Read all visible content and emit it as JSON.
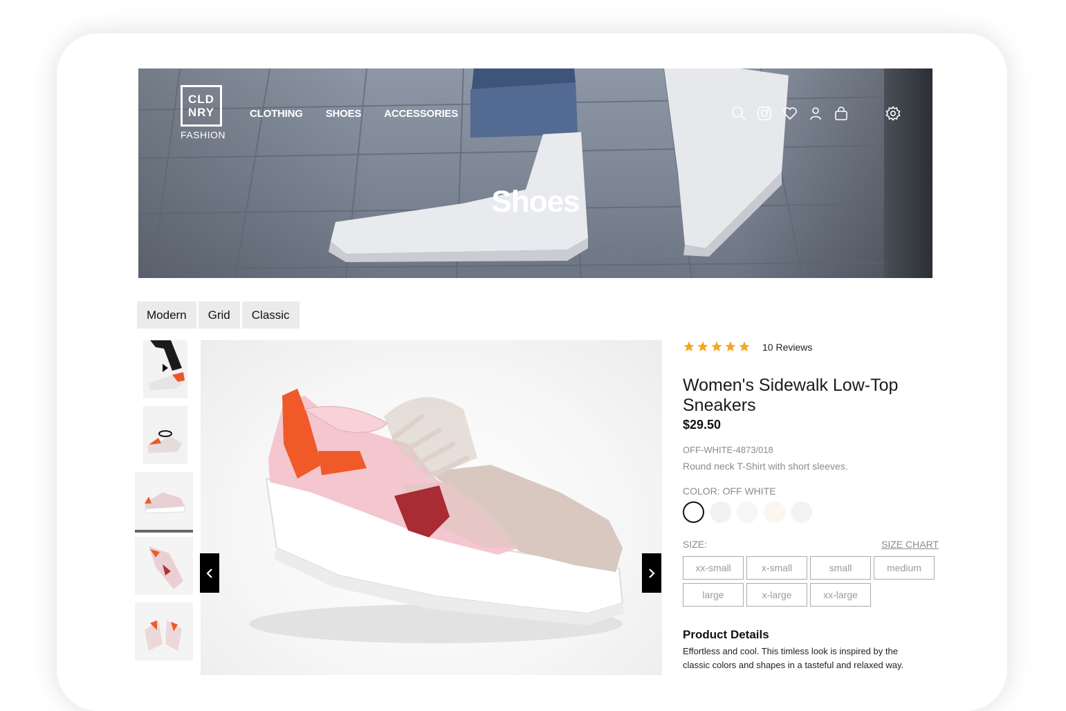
{
  "brand": {
    "logo_line1": "CLD",
    "logo_line2": "NRY",
    "logo_sub": "FASHION"
  },
  "nav": {
    "items": [
      "CLOTHING",
      "SHOES",
      "ACCESSORIES"
    ]
  },
  "header_icons": [
    "search-icon",
    "instagram-icon",
    "heart-icon",
    "user-icon",
    "bag-icon",
    "gear-icon"
  ],
  "hero": {
    "title": "Shoes"
  },
  "layout_tabs": [
    "Modern",
    "Grid",
    "Classic"
  ],
  "product": {
    "rating": 5,
    "reviews": "10 Reviews",
    "title": "Women's Sidewalk Low-Top Sneakers",
    "price": "$29.50",
    "sku": "OFF-WHITE-4873/018",
    "description": "Round neck T-Shirt with short sleeves.",
    "color_label": "COLOR: OFF WHITE",
    "colors": [
      "#ffffff",
      "#f1f1f1",
      "#f6f6f6",
      "#fbf6ef",
      "#f3f3f3"
    ],
    "size_label": "SIZE:",
    "size_chart": "SIZE CHART",
    "sizes": [
      "xx-small",
      "x-small",
      "small",
      "medium",
      "large",
      "x-large",
      "xx-large"
    ],
    "details_title": "Product Details",
    "details_text": "Effortless and cool. This timless look is inspired by the classic colors and shapes in a tasteful and relaxed way."
  },
  "colors": {
    "star": "#f5a623",
    "accent": "#000000"
  }
}
